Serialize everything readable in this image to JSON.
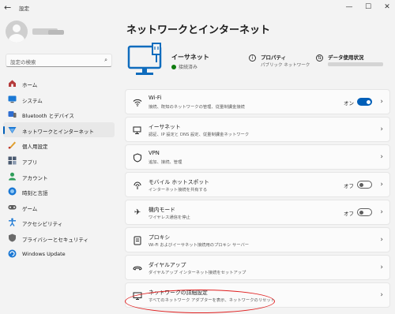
{
  "window": {
    "title": "設定"
  },
  "sidebar": {
    "search_placeholder": "設定の検索",
    "items": [
      {
        "label": "ホーム",
        "icon": "home-icon",
        "active": false
      },
      {
        "label": "システム",
        "icon": "system-icon",
        "active": false
      },
      {
        "label": "Bluetooth とデバイス",
        "icon": "bluetooth-icon",
        "active": false
      },
      {
        "label": "ネットワークとインターネット",
        "icon": "network-icon",
        "active": true
      },
      {
        "label": "個人用設定",
        "icon": "personalization-icon",
        "active": false
      },
      {
        "label": "アプリ",
        "icon": "apps-icon",
        "active": false
      },
      {
        "label": "アカウント",
        "icon": "account-icon",
        "active": false
      },
      {
        "label": "時刻と言語",
        "icon": "time-language-icon",
        "active": false
      },
      {
        "label": "ゲーム",
        "icon": "gaming-icon",
        "active": false
      },
      {
        "label": "アクセシビリティ",
        "icon": "accessibility-icon",
        "active": false
      },
      {
        "label": "プライバシーとセキュリティ",
        "icon": "privacy-icon",
        "active": false
      },
      {
        "label": "Windows Update",
        "icon": "update-icon",
        "active": false
      }
    ]
  },
  "main": {
    "title": "ネットワークとインターネット",
    "hero": {
      "name": "イーサネット",
      "status": "接続済み",
      "properties_title": "プロパティ",
      "properties_sub": "パブリック ネットワーク",
      "data_title": "データ使用状況"
    },
    "cards": [
      {
        "title": "Wi-Fi",
        "subtitle": "接続、既知のネットワークの管理、従量制課金接続",
        "icon": "wifi-icon",
        "toggle": true,
        "toggle_label": "オン",
        "toggle_on": true
      },
      {
        "title": "イーサネット",
        "subtitle": "認証、IP 設定と DNS 設定、従量制課金ネットワーク",
        "icon": "ethernet-icon",
        "toggle": false
      },
      {
        "title": "VPN",
        "subtitle": "追加、接続、管理",
        "icon": "vpn-icon",
        "toggle": false
      },
      {
        "title": "モバイル ホットスポット",
        "subtitle": "インターネット接続を共有する",
        "icon": "hotspot-icon",
        "toggle": true,
        "toggle_label": "オフ",
        "toggle_on": false
      },
      {
        "title": "機内モード",
        "subtitle": "ワイヤレス通信を停止",
        "icon": "airplane-icon",
        "toggle": true,
        "toggle_label": "オフ",
        "toggle_on": false
      },
      {
        "title": "プロキシ",
        "subtitle": "Wi-Fi およびイーサネット接続用のプロキシ サーバー",
        "icon": "proxy-icon",
        "toggle": false
      },
      {
        "title": "ダイヤルアップ",
        "subtitle": "ダイヤルアップ インターネット接続をセットアップ",
        "icon": "dialup-icon",
        "toggle": false
      },
      {
        "title": "ネットワークの詳細設定",
        "subtitle": "すべてのネットワーク アダプターを表示、ネットワークのリセット",
        "icon": "advanced-network-icon",
        "toggle": false
      }
    ]
  },
  "colors": {
    "accent": "#005fb8",
    "highlight": "#e02020",
    "connected": "#0f7b0f"
  }
}
